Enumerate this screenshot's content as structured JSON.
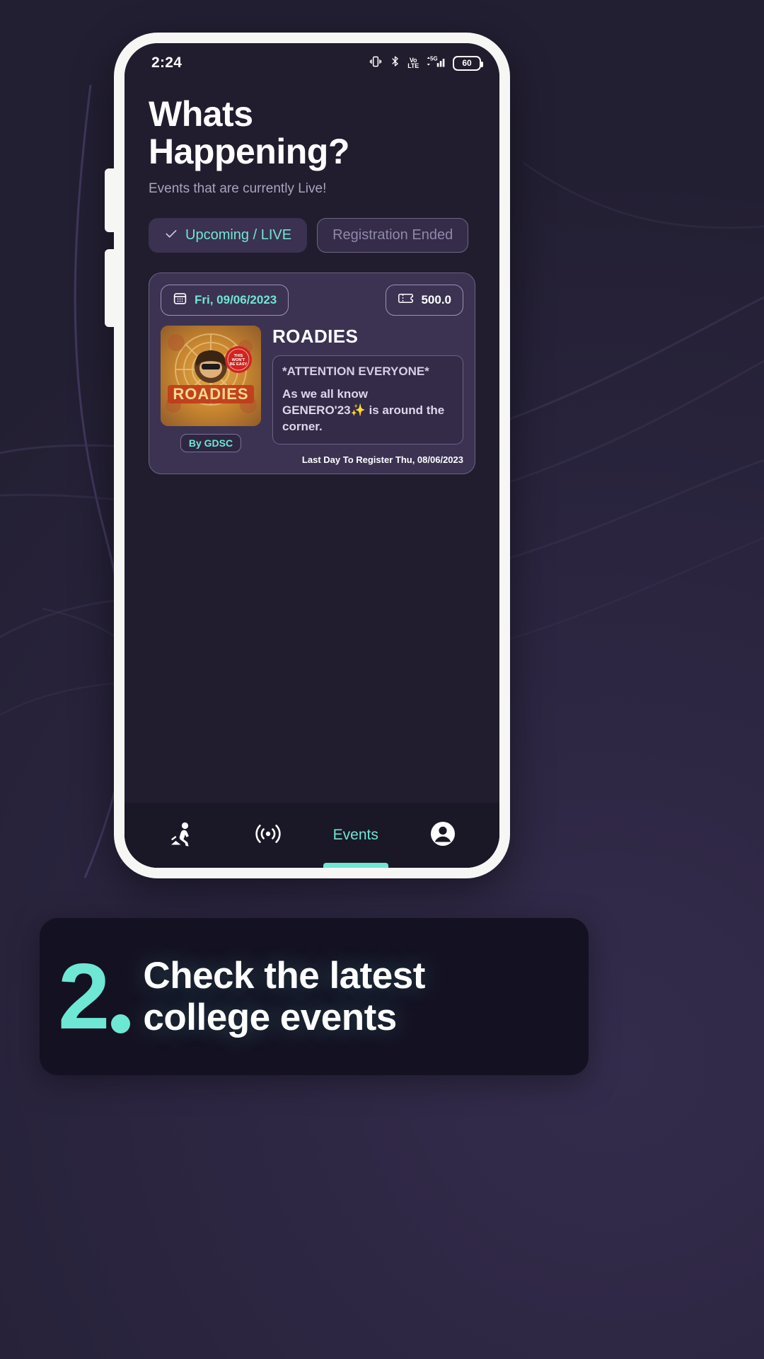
{
  "promo": {
    "caption_number": "2",
    "caption_line1": "Check the latest",
    "caption_line2": "college events",
    "accent_color": "#6ee7d4",
    "background_color": "#231f33"
  },
  "status_bar": {
    "time": "2:24",
    "battery_level": "60",
    "icons": [
      "vibrate-icon",
      "bluetooth-icon",
      "volte-icon",
      "signal-5g-icon",
      "battery-icon"
    ],
    "volte_top": "Vo",
    "volte_bottom": "LTE",
    "network_label": "5G"
  },
  "header": {
    "title_line1": "Whats",
    "title_line2": "Happening?",
    "subtitle": "Events that are currently Live!"
  },
  "filters": [
    {
      "label": "Upcoming / LIVE",
      "selected": true,
      "icon": "check-icon"
    },
    {
      "label": "Registration Ended",
      "selected": false
    }
  ],
  "event": {
    "date_label": "Fri, 09/06/2023",
    "date_icon": "calendar-icon",
    "price_label": "500.0",
    "price_icon": "ticket-icon",
    "title": "ROADIES",
    "organizer_badge": "By GDSC",
    "description_heading": "*ATTENTION EVERYONE*",
    "description_body": "As we all know GENERO'23✨ is around the corner.",
    "deadline": "Last Day To Register Thu, 08/06/2023"
  },
  "bottom_nav": [
    {
      "label": "",
      "icon": "activity-person-icon",
      "active": false
    },
    {
      "label": "",
      "icon": "broadcast-icon",
      "active": false
    },
    {
      "label": "Events",
      "icon": "",
      "active": true
    },
    {
      "label": "",
      "icon": "account-circle-icon",
      "active": false
    }
  ]
}
